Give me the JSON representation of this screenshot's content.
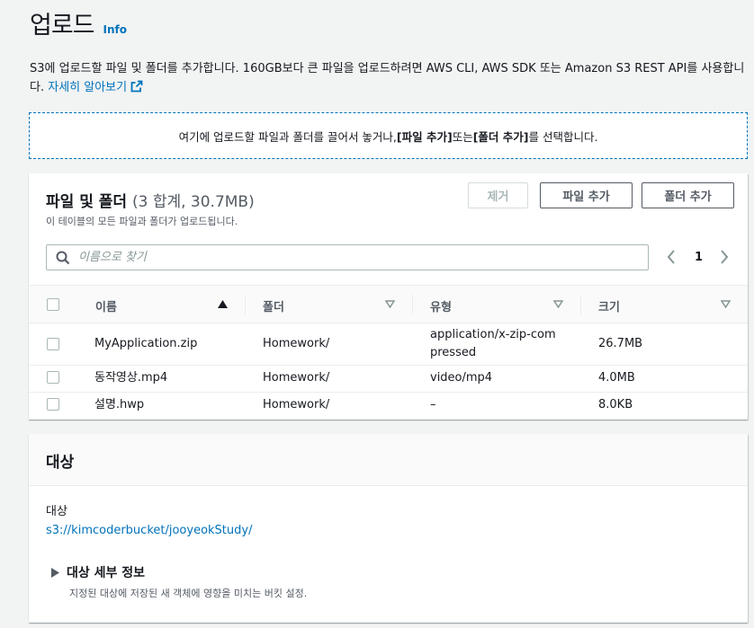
{
  "header": {
    "title": "업로드",
    "info": "Info"
  },
  "description": {
    "text": "S3에 업로드할 파일 및 폴더를 추가합니다. 160GB보다 큰 파일을 업로드하려면 AWS CLI, AWS SDK 또는 Amazon S3 REST API를 사용합니다.",
    "link": "자세히 알아보기"
  },
  "dropzone": {
    "prefix": "여기에 업로드할 파일과 폴더를 끌어서 놓거나, ",
    "add_files": "[파일 추가]",
    "middle": " 또는 ",
    "add_folder": "[폴더 추가]",
    "suffix": "를 선택합니다."
  },
  "files_panel": {
    "title": "파일 및 폴더",
    "count": "(3 합계, 30.7MB)",
    "subtitle": "이 테이블의 모든 파일과 폴더가 업로드됩니다.",
    "remove_button": "제거",
    "add_files_button": "파일 추가",
    "add_folder_button": "폴더 추가",
    "search_placeholder": "이름으로 찾기",
    "page": "1",
    "columns": {
      "name": "이름",
      "folder": "폴더",
      "type": "유형",
      "size": "크기"
    },
    "rows": [
      {
        "name": "MyApplication.zip",
        "folder": "Homework/",
        "type": "application/x-zip-compressed",
        "size": "26.7MB"
      },
      {
        "name": "동작영상.mp4",
        "folder": "Homework/",
        "type": "video/mp4",
        "size": "4.0MB"
      },
      {
        "name": "설명.hwp",
        "folder": "Homework/",
        "type": "–",
        "size": "8.0KB"
      }
    ]
  },
  "target_panel": {
    "title": "대상",
    "dest_label": "대상",
    "dest_value": "s3://kimcoderbucket/jooyeokStudy/",
    "details_label": "대상 세부 정보",
    "details_desc": "지정된 대상에 저장된 새 객체에 영향을 미치는 버킷 설정."
  },
  "colors": {
    "link": "#0073bb",
    "text": "#16191f",
    "muted": "#545b64",
    "background": "#f2f3f3"
  }
}
